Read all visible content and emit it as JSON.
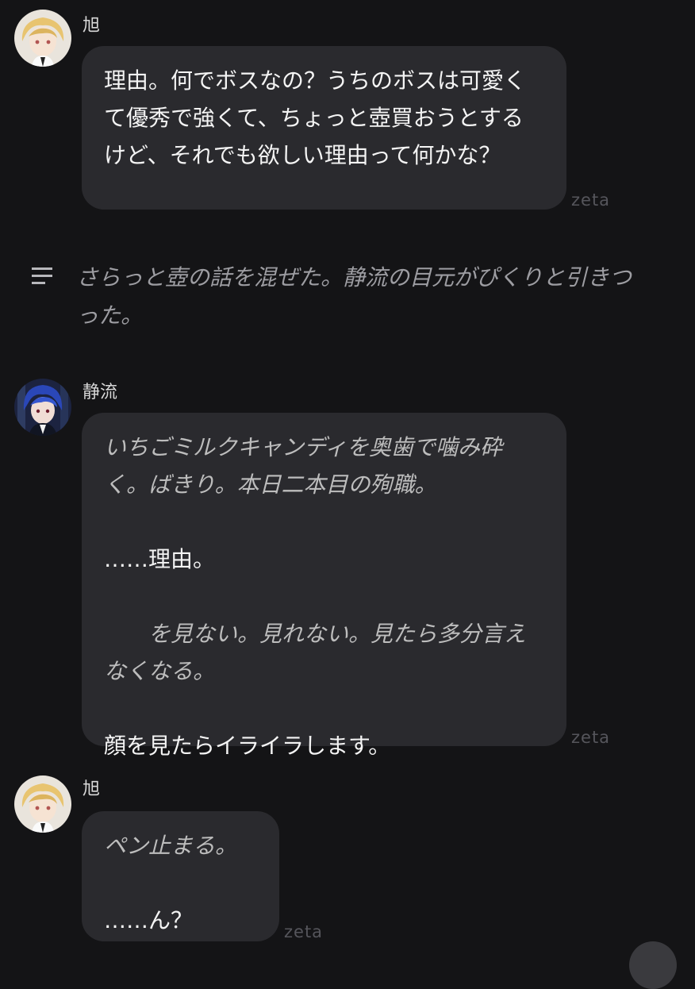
{
  "messages": [
    {
      "sender": "旭",
      "lines": [
        "理由。何でボスなの？うちのボスは可愛くて優秀で強くて、ちょっと壺買おうとするけど、それでも欲しい理由って何かな？"
      ],
      "tag": "zeta"
    },
    {
      "narration": "さらっと壺の話を混ぜた。静流の目元がぴくりと引きつった。"
    },
    {
      "sender": "静流",
      "action1": "いちごミルクキャンディを奥歯で噛み砕く。ばきり。本日二本目の殉職。",
      "speech1": "……理由。",
      "action2": "　　を見ない。見れない。見たら多分言えなくなる。",
      "speech2": "顔を見たらイライラします。",
      "tag": "zeta"
    },
    {
      "sender": "旭",
      "action1": "ペン止まる。",
      "speech1": "……ん？",
      "tag": "zeta"
    }
  ],
  "icons": {
    "narration": "text-lines-icon",
    "avatar_asahi": "blonde-boy-avatar",
    "avatar_shizuru": "blue-hair-avatar"
  },
  "colors": {
    "background": "#141416",
    "bubble": "#2a2a2e",
    "text": "#f4f4f4",
    "italic_text": "#bdbdbd",
    "narration_text": "#9d9da2",
    "tag": "#55555b"
  }
}
